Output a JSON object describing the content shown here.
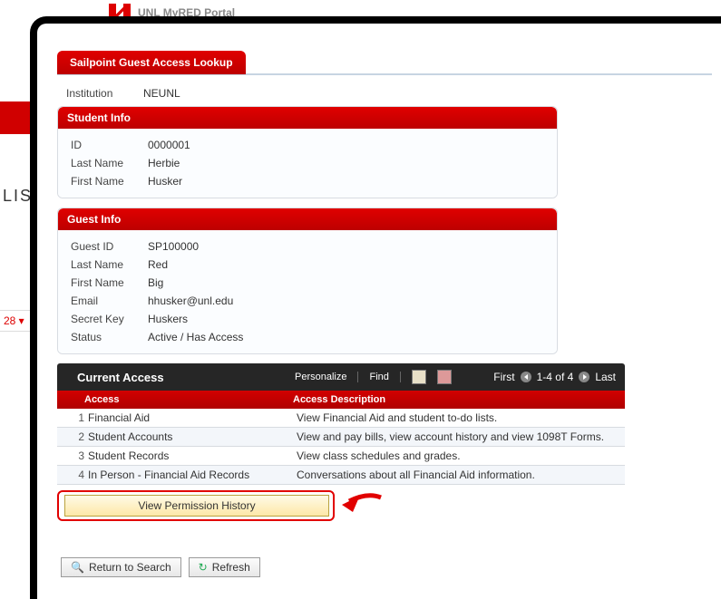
{
  "background": {
    "portal_text": "UNL MyRED Portal",
    "lis_fragment": "LIS",
    "left_tag": "28 ▾"
  },
  "page": {
    "tab_title": "Sailpoint Guest Access Lookup",
    "institution_label": "Institution",
    "institution_value": "NEUNL"
  },
  "student": {
    "heading": "Student Info",
    "id_label": "ID",
    "id_value": "0000001",
    "last_label": "Last Name",
    "last_value": "Herbie",
    "first_label": "First Name",
    "first_value": "Husker"
  },
  "guest": {
    "heading": "Guest Info",
    "id_label": "Guest ID",
    "id_value": "SP100000",
    "last_label": "Last Name",
    "last_value": "Red",
    "first_label": "First Name",
    "first_value": "Big",
    "email_label": "Email",
    "email_value": "hhusker@unl.edu",
    "secret_label": "Secret Key",
    "secret_value": "Huskers",
    "status_label": "Status",
    "status_value": "Active / Has Access"
  },
  "grid": {
    "title": "Current Access",
    "personalize": "Personalize",
    "find": "Find",
    "first": "First",
    "range": "1-4 of 4",
    "last": "Last",
    "col_access": "Access",
    "col_desc": "Access Description",
    "rows": [
      {
        "n": "1",
        "access": "Financial Aid",
        "desc": "View Financial Aid and student to-do lists."
      },
      {
        "n": "2",
        "access": "Student Accounts",
        "desc": "View and pay bills, view account history and view 1098T Forms."
      },
      {
        "n": "3",
        "access": "Student Records",
        "desc": "View class schedules and grades."
      },
      {
        "n": "4",
        "access": "In Person - Financial Aid Records",
        "desc": "Conversations about all Financial Aid information."
      }
    ]
  },
  "buttons": {
    "view_history": "View Permission History",
    "return_search": "Return to Search",
    "refresh": "Refresh"
  }
}
